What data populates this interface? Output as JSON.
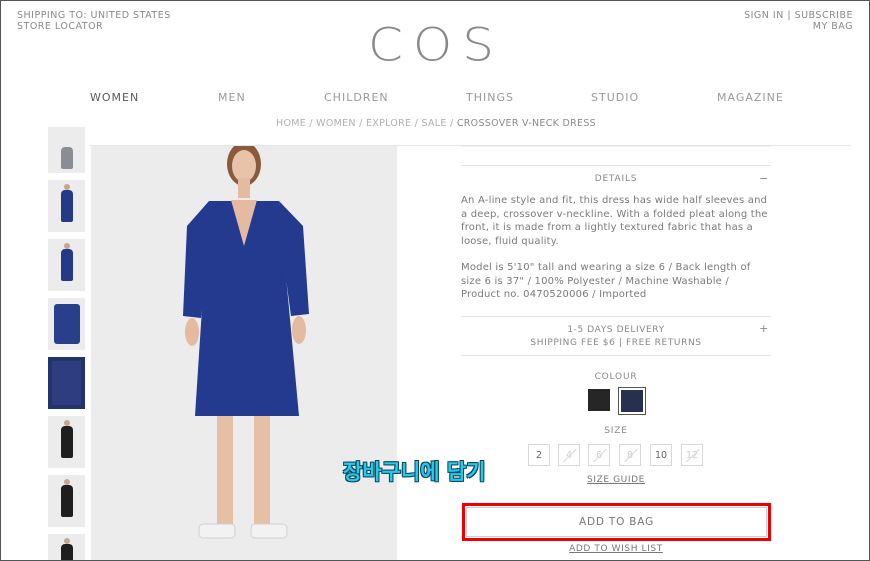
{
  "header": {
    "shipping": "SHIPPING TO: UNITED STATES",
    "store_locator": "STORE LOCATOR",
    "sign_in": "SIGN IN",
    "separator": "|",
    "subscribe": "SUBSCRIBE",
    "my_bag": "MY BAG",
    "logo": "COS"
  },
  "nav": {
    "items": [
      {
        "label": "WOMEN",
        "active": true
      },
      {
        "label": "MEN"
      },
      {
        "label": "CHILDREN"
      },
      {
        "label": "THINGS"
      },
      {
        "label": "STUDIO"
      },
      {
        "label": "MAGAZINE"
      }
    ]
  },
  "breadcrumb": {
    "path": "HOME / WOMEN / EXPLORE / SALE / ",
    "current": "CROSSOVER V-NECK DRESS"
  },
  "product": {
    "details_label": "DETAILS",
    "details_toggle": "−",
    "description_1": "An A-line style and fit, this dress has wide half sleeves and a deep, crossover v-neckline. With a folded pleat along the front, it is made from a lightly textured fabric that has a loose, fluid quality.",
    "description_2": "Model is 5'10\" tall and wearing a size 6 / Back length of size 6 is 37\"  / 100% Polyester / Machine Washable / Product no. 0470520006 / Imported",
    "delivery_line1": "1-5 DAYS DELIVERY",
    "delivery_line2": "SHIPPING FEE $6 | FREE RETURNS",
    "delivery_toggle": "+",
    "colour_label": "COLOUR",
    "colours": [
      "#262626",
      "#28304f"
    ],
    "size_label": "SIZE",
    "sizes": [
      "2",
      "4",
      "6",
      "8",
      "10",
      "12"
    ],
    "size_guide": "SIZE GUIDE",
    "add_to_bag": "ADD TO BAG",
    "add_to_wishlist": "ADD TO WISH LIST"
  },
  "annotation": {
    "caption": "장바구니에 담기",
    "highlight_color": "#ee0000"
  }
}
